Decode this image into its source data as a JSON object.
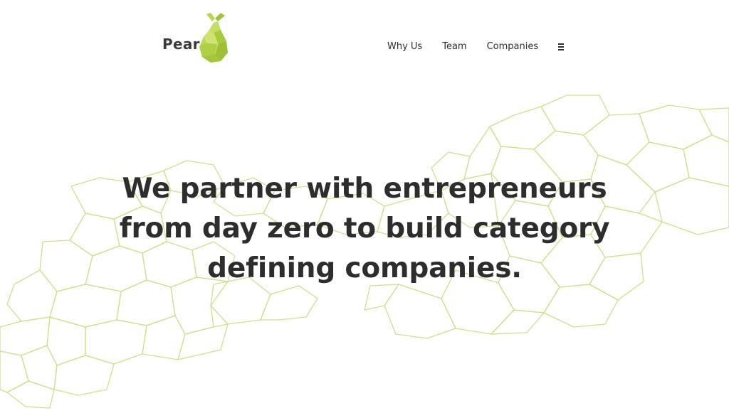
{
  "brand": {
    "name": "Pear",
    "logo_icon": "pear-icon",
    "accent": "#a6cc3a",
    "mesh_color": "#cfe08a"
  },
  "nav": {
    "items": [
      {
        "label": "Why Us"
      },
      {
        "label": "Team"
      },
      {
        "label": "Companies"
      }
    ],
    "menu_icon": "hamburger-menu-icon"
  },
  "hero": {
    "line1": "We partner with entrepreneurs",
    "line2": "from day zero to build category",
    "line3": "defining companies."
  }
}
